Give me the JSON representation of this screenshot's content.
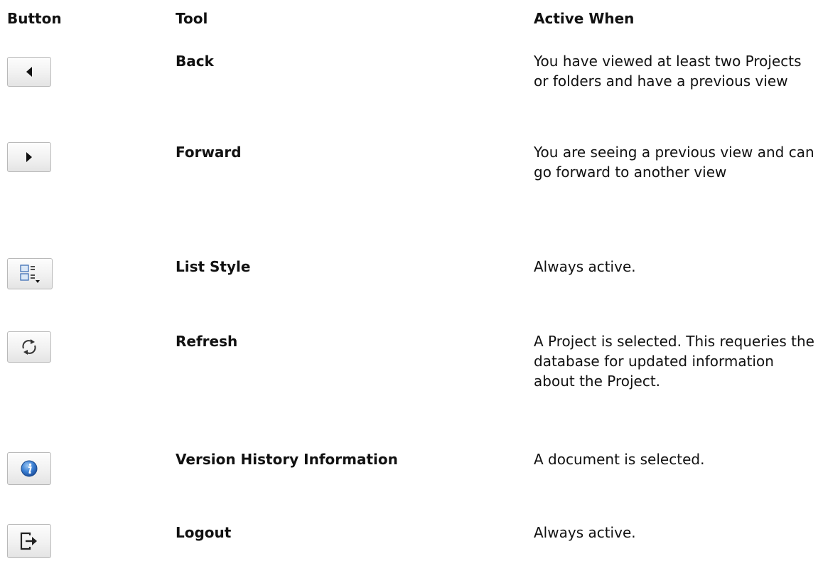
{
  "headers": {
    "button": "Button",
    "tool": "Tool",
    "active_when": "Active When"
  },
  "rows": [
    {
      "icon": "back-arrow-icon",
      "tool": "Back",
      "active_when": "You have viewed at least two Projects or folders and have a previous view"
    },
    {
      "icon": "forward-arrow-icon",
      "tool": "Forward",
      "active_when": "You are seeing a previous view and can go forward to another view"
    },
    {
      "icon": "list-style-icon",
      "tool": "List Style",
      "active_when": "Always active."
    },
    {
      "icon": "refresh-icon",
      "tool": "Refresh",
      "active_when": "A Project is selected. This requeries the database for updated information about the Project."
    },
    {
      "icon": "info-icon",
      "tool": "Version History Information",
      "active_when": "A document is selected."
    },
    {
      "icon": "logout-icon",
      "tool": "Logout",
      "active_when": "Always active."
    }
  ]
}
